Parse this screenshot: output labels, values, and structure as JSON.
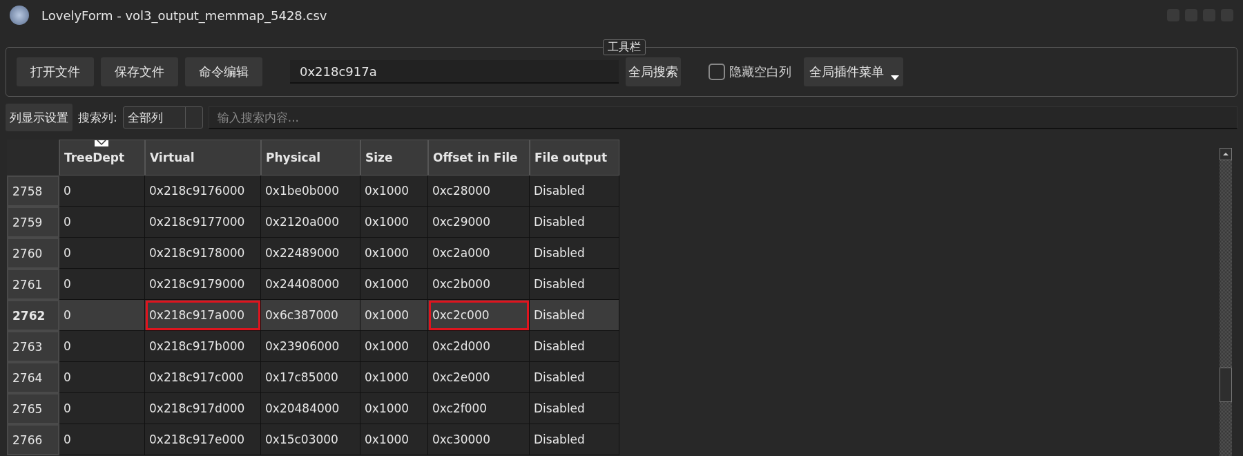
{
  "window": {
    "title": "LovelyForm - vol3_output_memmap_5428.csv"
  },
  "toolbar": {
    "title": "工具栏",
    "buttons": [
      "打开文件",
      "保存文件",
      "命令编辑"
    ],
    "search_value": "0x218c917a",
    "search_button": "全局搜索",
    "hide_empty": {
      "label": "隐藏空白列",
      "checked": false
    },
    "plugin_menu": "全局插件菜单"
  },
  "filter": {
    "settings_button": "列显示设置",
    "column_label": "搜索列:",
    "column_value": "全部列",
    "placeholder": "输入搜索内容..."
  },
  "table": {
    "columns": [
      "TreeDept",
      "Virtual",
      "Physical",
      "Size",
      "Offset in File",
      "File output"
    ],
    "rows": [
      {
        "id": "2758",
        "selected": false,
        "cells": [
          {
            "text": "0",
            "outlined": false
          },
          {
            "text": "0x218c9176000",
            "outlined": false
          },
          {
            "text": "0x1be0b000",
            "outlined": false
          },
          {
            "text": "0x1000",
            "outlined": false
          },
          {
            "text": "0xc28000",
            "outlined": false
          },
          {
            "text": "Disabled",
            "outlined": false
          }
        ]
      },
      {
        "id": "2759",
        "selected": false,
        "cells": [
          {
            "text": "0",
            "outlined": false
          },
          {
            "text": "0x218c9177000",
            "outlined": false
          },
          {
            "text": "0x2120a000",
            "outlined": false
          },
          {
            "text": "0x1000",
            "outlined": false
          },
          {
            "text": "0xc29000",
            "outlined": false
          },
          {
            "text": "Disabled",
            "outlined": false
          }
        ]
      },
      {
        "id": "2760",
        "selected": false,
        "cells": [
          {
            "text": "0",
            "outlined": false
          },
          {
            "text": "0x218c9178000",
            "outlined": false
          },
          {
            "text": "0x22489000",
            "outlined": false
          },
          {
            "text": "0x1000",
            "outlined": false
          },
          {
            "text": "0xc2a000",
            "outlined": false
          },
          {
            "text": "Disabled",
            "outlined": false
          }
        ]
      },
      {
        "id": "2761",
        "selected": false,
        "cells": [
          {
            "text": "0",
            "outlined": false
          },
          {
            "text": "0x218c9179000",
            "outlined": false
          },
          {
            "text": "0x24408000",
            "outlined": false
          },
          {
            "text": "0x1000",
            "outlined": false
          },
          {
            "text": "0xc2b000",
            "outlined": false
          },
          {
            "text": "Disabled",
            "outlined": false
          }
        ]
      },
      {
        "id": "2762",
        "selected": true,
        "cells": [
          {
            "text": "0",
            "outlined": false
          },
          {
            "text": "0x218c917a000",
            "outlined": true
          },
          {
            "text": "0x6c387000",
            "outlined": false
          },
          {
            "text": "0x1000",
            "outlined": false
          },
          {
            "text": "0xc2c000",
            "outlined": true
          },
          {
            "text": "Disabled",
            "outlined": false
          }
        ]
      },
      {
        "id": "2763",
        "selected": false,
        "cells": [
          {
            "text": "0",
            "outlined": false
          },
          {
            "text": "0x218c917b000",
            "outlined": false
          },
          {
            "text": "0x23906000",
            "outlined": false
          },
          {
            "text": "0x1000",
            "outlined": false
          },
          {
            "text": "0xc2d000",
            "outlined": false
          },
          {
            "text": "Disabled",
            "outlined": false
          }
        ]
      },
      {
        "id": "2764",
        "selected": false,
        "cells": [
          {
            "text": "0",
            "outlined": false
          },
          {
            "text": "0x218c917c000",
            "outlined": false
          },
          {
            "text": "0x17c85000",
            "outlined": false
          },
          {
            "text": "0x1000",
            "outlined": false
          },
          {
            "text": "0xc2e000",
            "outlined": false
          },
          {
            "text": "Disabled",
            "outlined": false
          }
        ]
      },
      {
        "id": "2765",
        "selected": false,
        "cells": [
          {
            "text": "0",
            "outlined": false
          },
          {
            "text": "0x218c917d000",
            "outlined": false
          },
          {
            "text": "0x20484000",
            "outlined": false
          },
          {
            "text": "0x1000",
            "outlined": false
          },
          {
            "text": "0xc2f000",
            "outlined": false
          },
          {
            "text": "Disabled",
            "outlined": false
          }
        ]
      },
      {
        "id": "2766",
        "selected": false,
        "cells": [
          {
            "text": "0",
            "outlined": false
          },
          {
            "text": "0x218c917e000",
            "outlined": false
          },
          {
            "text": "0x15c03000",
            "outlined": false
          },
          {
            "text": "0x1000",
            "outlined": false
          },
          {
            "text": "0xc30000",
            "outlined": false
          },
          {
            "text": "Disabled",
            "outlined": false
          }
        ]
      }
    ]
  }
}
